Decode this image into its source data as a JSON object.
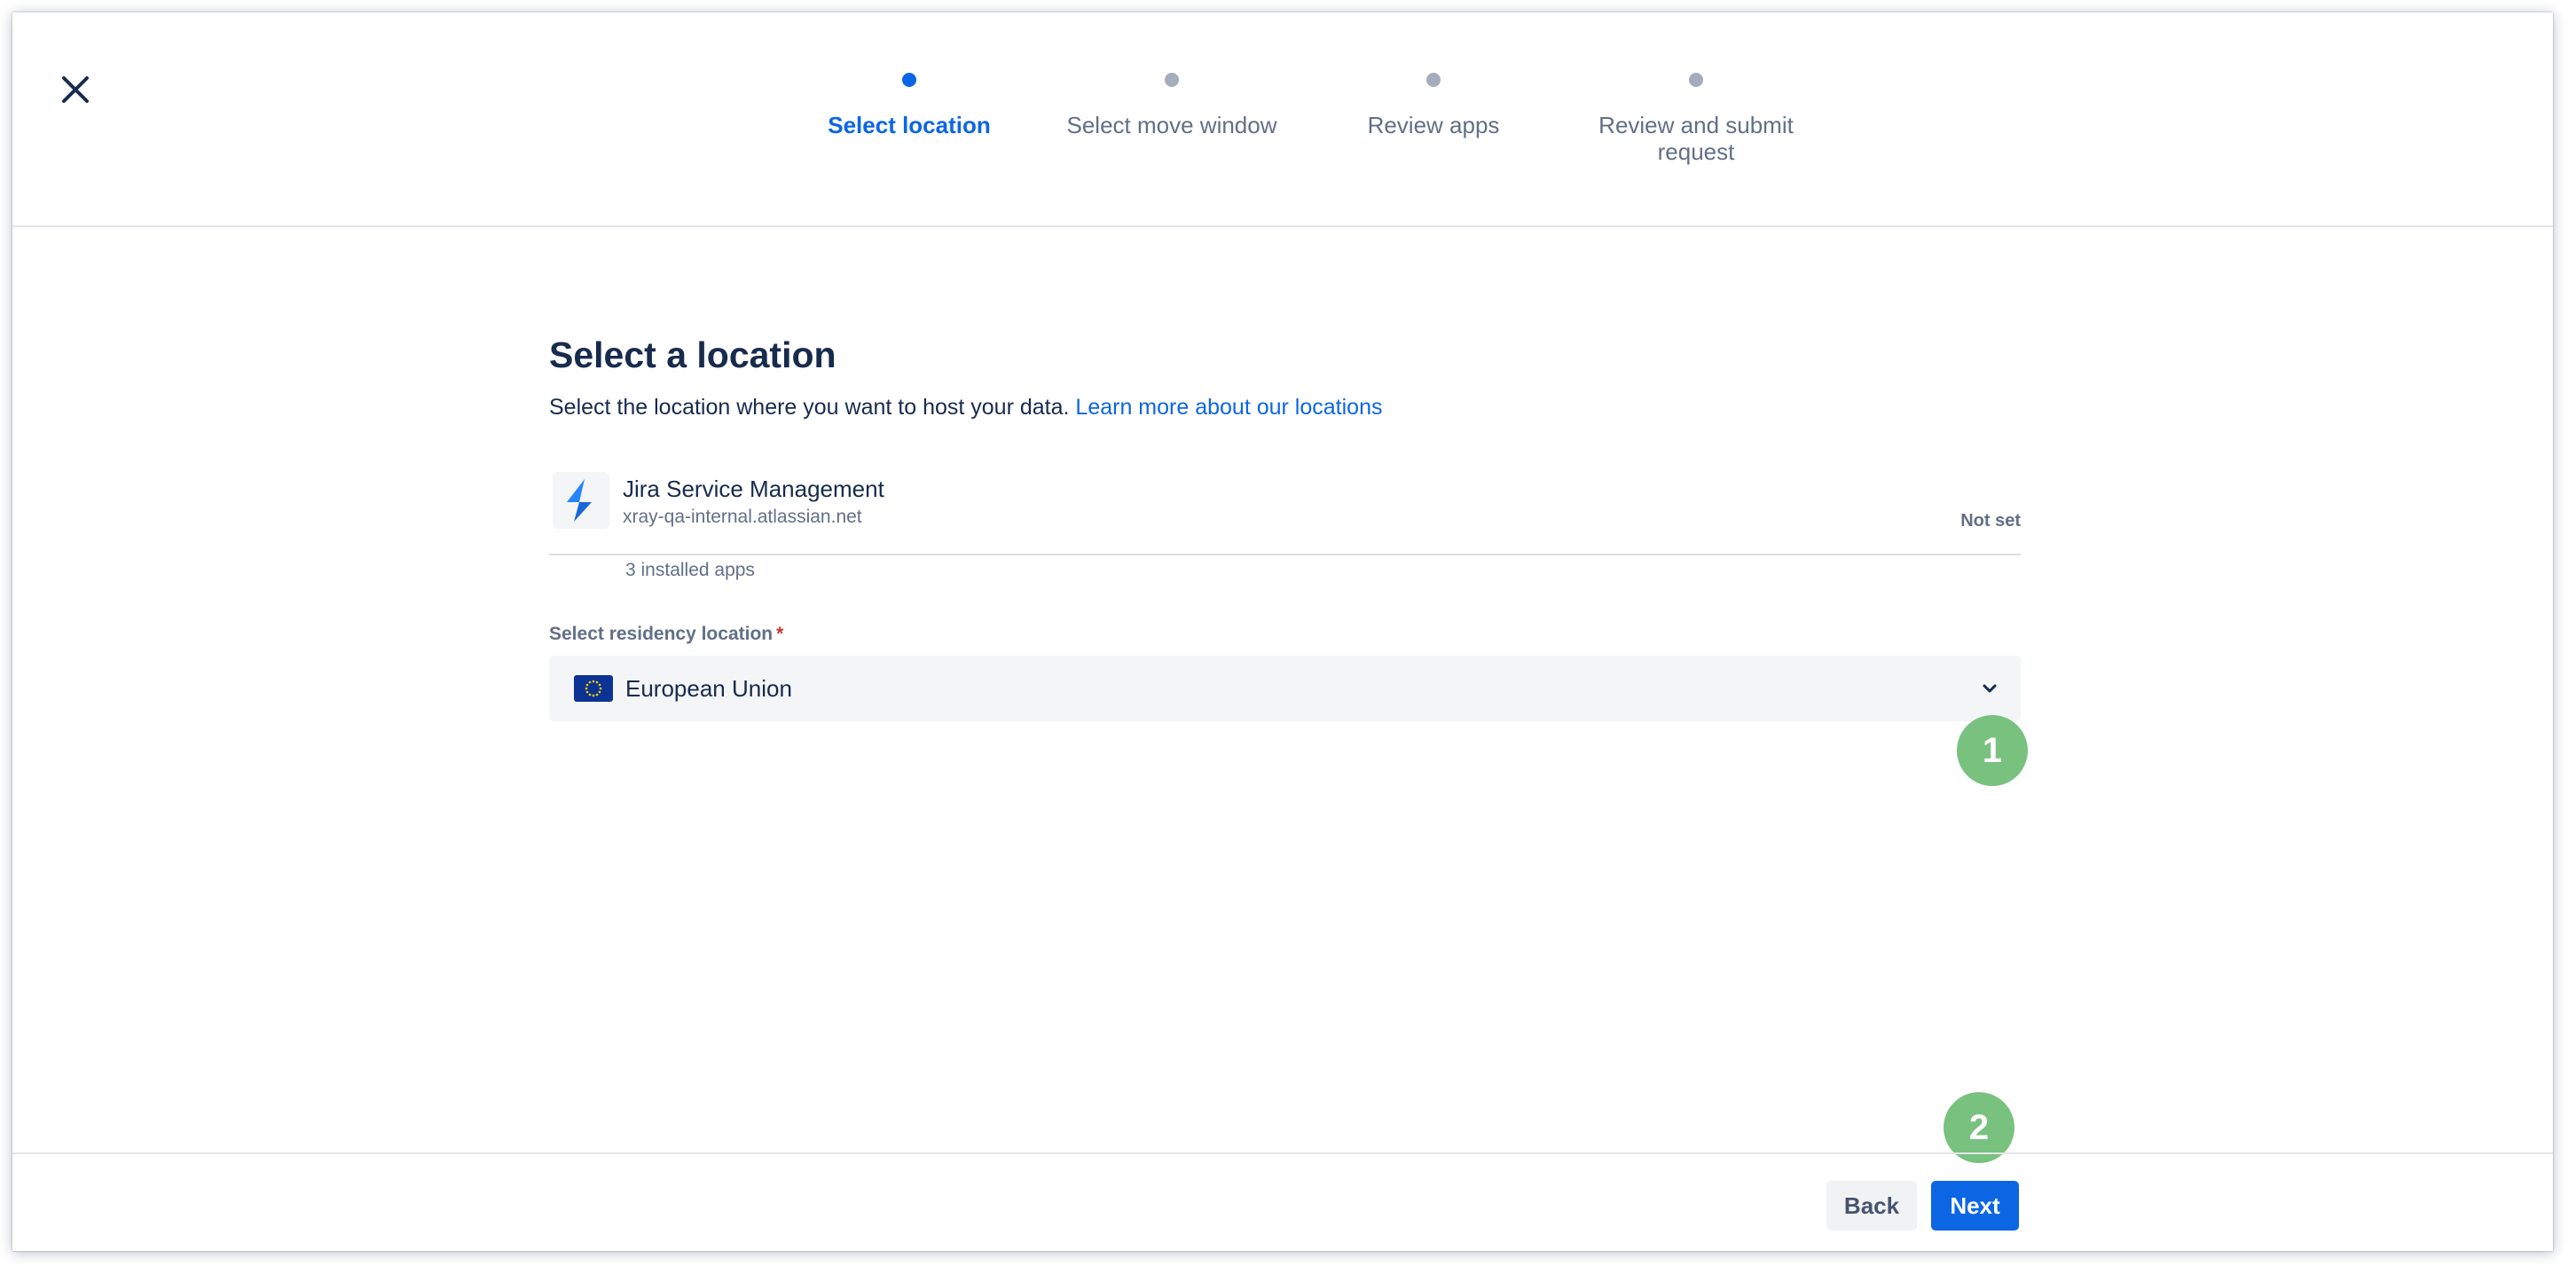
{
  "stepper": {
    "steps": [
      {
        "label": "Select location",
        "state": "active"
      },
      {
        "label": "Select move window",
        "state": "upcoming"
      },
      {
        "label": "Review apps",
        "state": "upcoming"
      },
      {
        "label": "Review and submit request",
        "state": "upcoming"
      }
    ]
  },
  "main": {
    "title": "Select a location",
    "subtitle": "Select the location where you want to host your data.",
    "learn_more_link": "Learn more about our locations"
  },
  "product": {
    "name": "Jira Service Management",
    "url": "xray-qa-internal.atlassian.net",
    "status": "Not set",
    "apps_count": "3 installed apps",
    "icon": "jira-service-management-icon"
  },
  "residency": {
    "label": "Select residency location",
    "required_marker": "*",
    "selected_value": "European Union",
    "flag_icon": "eu-flag-icon"
  },
  "markers": [
    "1",
    "2"
  ],
  "footer": {
    "back_label": "Back",
    "next_label": "Next"
  },
  "colors": {
    "primary": "#0c66e4",
    "text": "#172b4d",
    "subtle_text": "#626f86",
    "marker": "#79c17f",
    "required": "#c9372c",
    "eu_flag": "#0b3394"
  }
}
